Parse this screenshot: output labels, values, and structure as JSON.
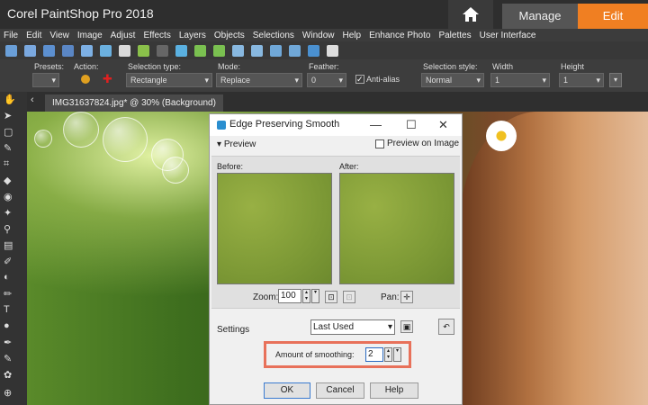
{
  "window": {
    "title": "Corel PaintShop Pro 2018",
    "tabs": {
      "manage": "Manage",
      "edit": "Edit"
    }
  },
  "menu": [
    "File",
    "Edit",
    "View",
    "Image",
    "Adjust",
    "Effects",
    "Layers",
    "Objects",
    "Selections",
    "Window",
    "Help",
    "Enhance Photo",
    "Palettes",
    "User Interface"
  ],
  "options": {
    "presets_label": "Presets:",
    "action_label": "Action:",
    "selection_type_label": "Selection type:",
    "selection_type_value": "Rectangle",
    "mode_label": "Mode:",
    "mode_value": "Replace",
    "feather_label": "Feather:",
    "feather_value": "0",
    "antialias_label": "Anti-alias",
    "selection_style_label": "Selection style:",
    "selection_style_value": "Normal",
    "width_label": "Width",
    "width_value": "1",
    "height_label": "Height",
    "height_value": "1"
  },
  "document": {
    "tab_label": "IMG31637824.jpg* @  30% (Background)"
  },
  "dialog": {
    "title": "Edge Preserving Smooth",
    "preview_label": "Preview",
    "preview_on_image": "Preview on Image",
    "before_label": "Before:",
    "after_label": "After:",
    "zoom_label": "Zoom:",
    "zoom_value": "100",
    "pan_label": "Pan:",
    "settings_label": "Settings",
    "settings_value": "Last Used",
    "amount_label": "Amount of smoothing:",
    "amount_value": "2",
    "ok": "OK",
    "cancel": "Cancel",
    "help": "Help"
  },
  "colors": {
    "accent": "#f07f22",
    "highlight": "#e8715a"
  }
}
